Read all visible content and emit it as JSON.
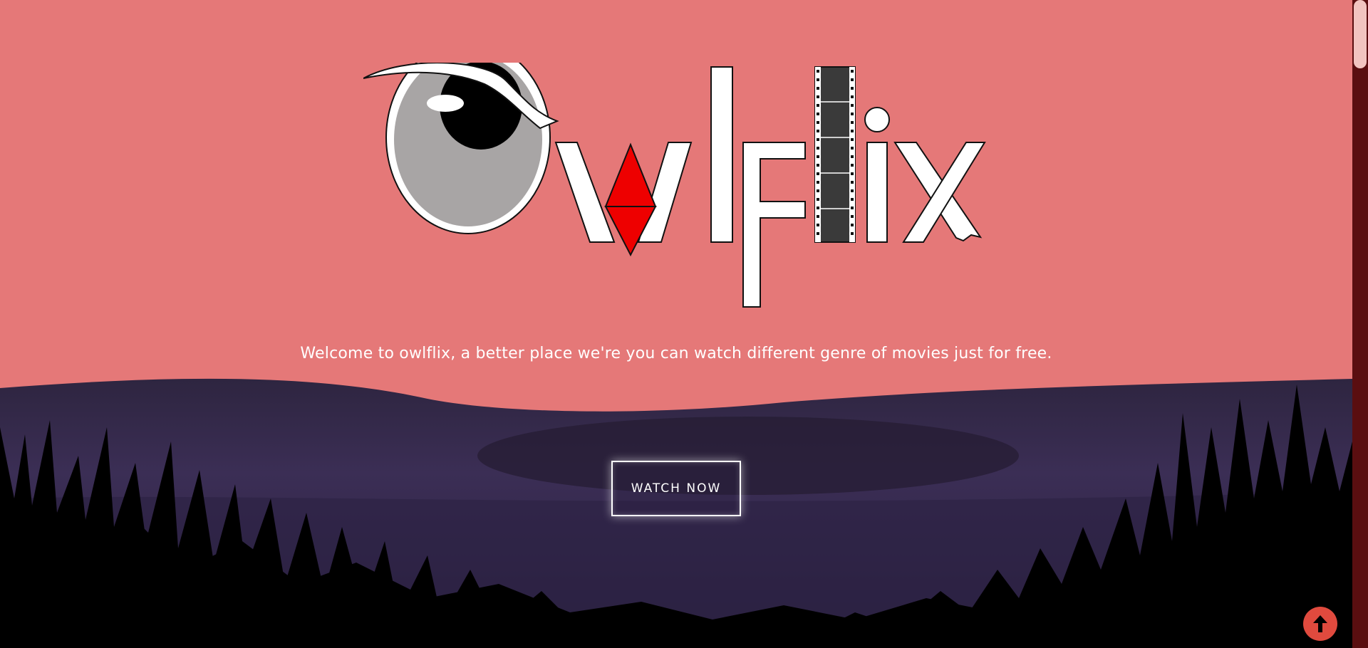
{
  "brand": {
    "logo_text": "owlfix",
    "tagline": "Welcome to owlflix, a better place we're you can watch different genre of movies just for free."
  },
  "hero": {
    "cta_label": "WATCH NOW"
  },
  "controls": {
    "back_to_top_icon": "arrow-up-icon"
  },
  "colors": {
    "sky": "#e57878",
    "hills": "#3a2d52",
    "grass": "#000000",
    "scrollbar_track": "#5a0e10",
    "scrollbar_thumb": "#f2c4c0",
    "back_to_top": "#e04a3e",
    "logo_accent": "#ee0000"
  }
}
